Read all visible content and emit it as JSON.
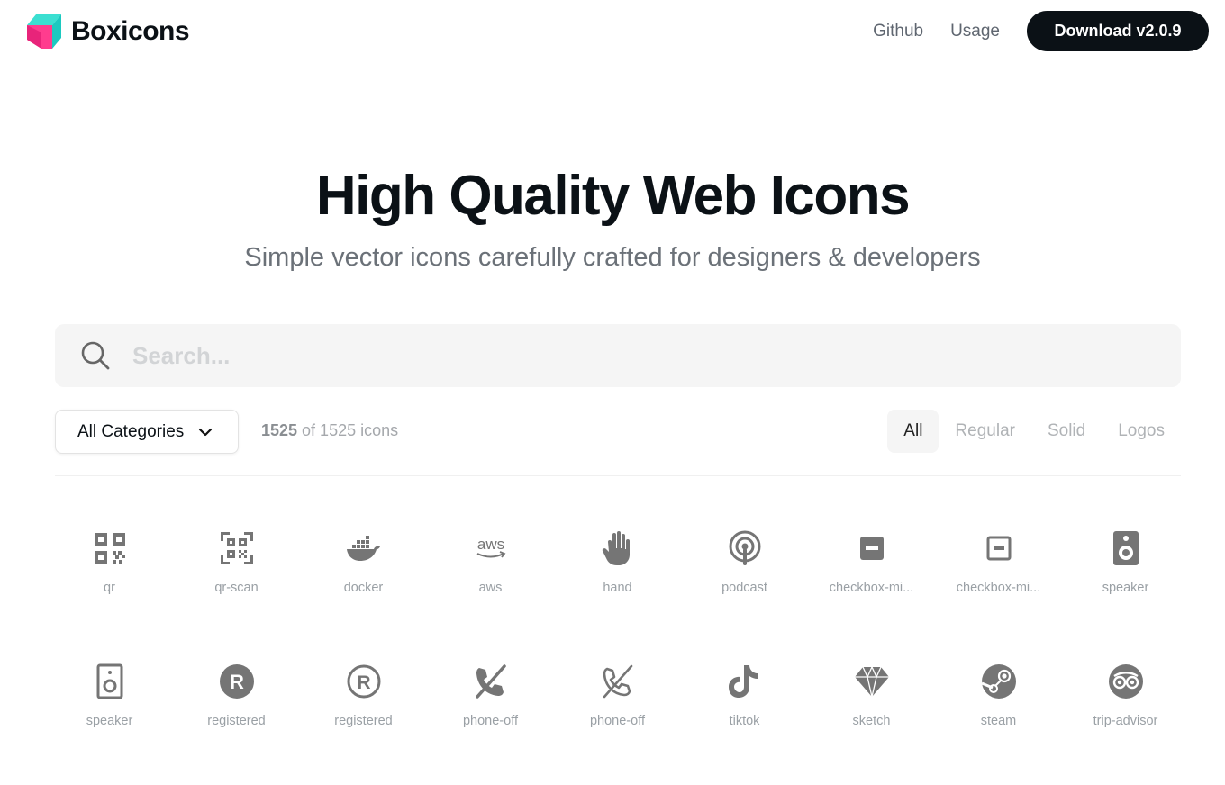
{
  "brand": {
    "name": "Boxicons"
  },
  "nav": {
    "github": "Github",
    "usage": "Usage",
    "download": "Download v2.0.9"
  },
  "hero": {
    "title": "High Quality Web Icons",
    "subtitle": "Simple vector icons carefully crafted for designers & developers"
  },
  "search": {
    "placeholder": "Search...",
    "value": ""
  },
  "filters": {
    "category": "All Categories",
    "count_shown": "1525",
    "count_rest": " of 1525 icons",
    "types": [
      "All",
      "Regular",
      "Solid",
      "Logos"
    ],
    "active_type": "All"
  },
  "icons": [
    {
      "name": "qr",
      "icon": "qr-icon"
    },
    {
      "name": "qr-scan",
      "icon": "qr-scan-icon"
    },
    {
      "name": "docker",
      "icon": "docker-icon"
    },
    {
      "name": "aws",
      "icon": "aws-icon"
    },
    {
      "name": "hand",
      "icon": "hand-icon"
    },
    {
      "name": "podcast",
      "icon": "podcast-icon"
    },
    {
      "name": "checkbox-mi...",
      "icon": "checkbox-minus-solid-icon"
    },
    {
      "name": "checkbox-mi...",
      "icon": "checkbox-minus-icon"
    },
    {
      "name": "speaker",
      "icon": "speaker-solid-icon"
    },
    {
      "name": "speaker",
      "icon": "speaker-icon"
    },
    {
      "name": "registered",
      "icon": "registered-solid-icon"
    },
    {
      "name": "registered",
      "icon": "registered-icon"
    },
    {
      "name": "phone-off",
      "icon": "phone-off-solid-icon"
    },
    {
      "name": "phone-off",
      "icon": "phone-off-icon"
    },
    {
      "name": "tiktok",
      "icon": "tiktok-icon"
    },
    {
      "name": "sketch",
      "icon": "sketch-icon"
    },
    {
      "name": "steam",
      "icon": "steam-icon"
    },
    {
      "name": "trip-advisor",
      "icon": "trip-advisor-icon"
    }
  ],
  "colors": {
    "brand_teal": "#40e0d0",
    "brand_pink": "#ff3f8e",
    "text_dark": "#0b1116",
    "icon_gray": "#757575"
  }
}
